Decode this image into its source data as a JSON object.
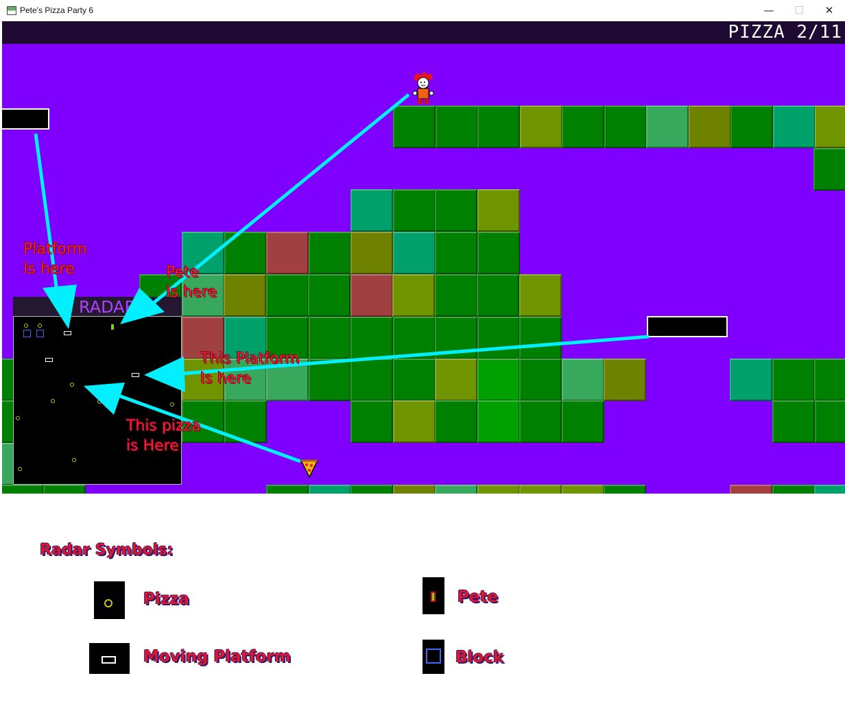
{
  "window": {
    "title": "Pete's Pizza Party 6",
    "minimize": "—",
    "maximize": "☐",
    "close": "✕"
  },
  "hud": {
    "pizza_counter": "PIZZA 2/11"
  },
  "radar": {
    "label": "RADAR"
  },
  "annotations": {
    "platform_top": "Platform\nIs here",
    "pete": "Pete\nIs here",
    "platform_right": "This Platform\nIs here",
    "pizza": "This pizza\nis Here"
  },
  "legend": {
    "title": "Radar Symbols:",
    "pizza": "Pizza",
    "moving_platform": "Moving Platform",
    "pete": "Pete",
    "block": "Block"
  },
  "colors": {
    "sky": "#8000ff",
    "hud": "#1e0a33",
    "arrow": "#00f0ff",
    "annotation": "#e8203a",
    "radar_pizza": "#c8c800",
    "radar_block": "#4a60ff",
    "radar_pete": "#7ed020"
  }
}
